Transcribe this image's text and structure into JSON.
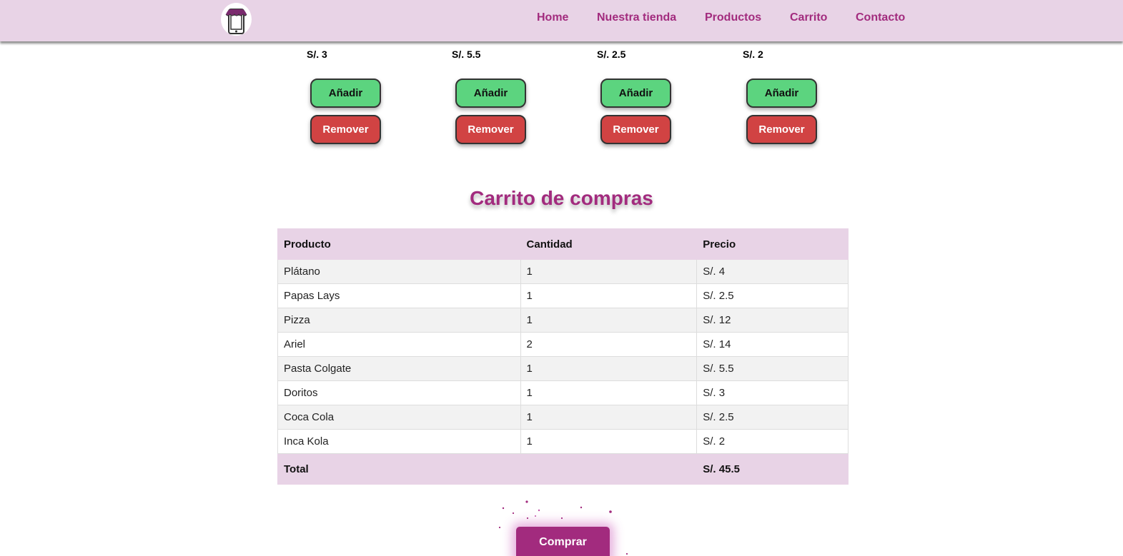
{
  "nav": {
    "logo": "store-phone-logo",
    "links": [
      "Home",
      "Nuestra tienda",
      "Productos",
      "Carrito",
      "Contacto"
    ]
  },
  "products": [
    {
      "price": "S/. 3",
      "add_label": "Añadir",
      "remove_label": "Remover"
    },
    {
      "price": "S/. 5.5",
      "add_label": "Añadir",
      "remove_label": "Remover"
    },
    {
      "price": "S/. 2.5",
      "add_label": "Añadir",
      "remove_label": "Remover"
    },
    {
      "price": "S/. 2",
      "add_label": "Añadir",
      "remove_label": "Remover"
    }
  ],
  "cart": {
    "title": "Carrito de compras",
    "headers": [
      "Producto",
      "Cantidad",
      "Precio"
    ],
    "rows": [
      [
        "Plátano",
        "1",
        "S/. 4"
      ],
      [
        "Papas Lays",
        "1",
        "S/. 2.5"
      ],
      [
        "Pizza",
        "1",
        "S/. 12"
      ],
      [
        "Ariel",
        "2",
        "S/. 14"
      ],
      [
        "Pasta Colgate",
        "1",
        "S/. 5.5"
      ],
      [
        "Doritos",
        "1",
        "S/. 3"
      ],
      [
        "Coca Cola",
        "1",
        "S/. 2.5"
      ],
      [
        "Inca Kola",
        "1",
        "S/. 2"
      ]
    ],
    "total_label": "Total",
    "total_value": "S/. 45.5"
  },
  "buy_label": "Comprar",
  "colors": {
    "brand": "#a22b7e",
    "nav_bg": "#e8d3e6",
    "add": "#5cd47f",
    "remove": "#d14343"
  }
}
